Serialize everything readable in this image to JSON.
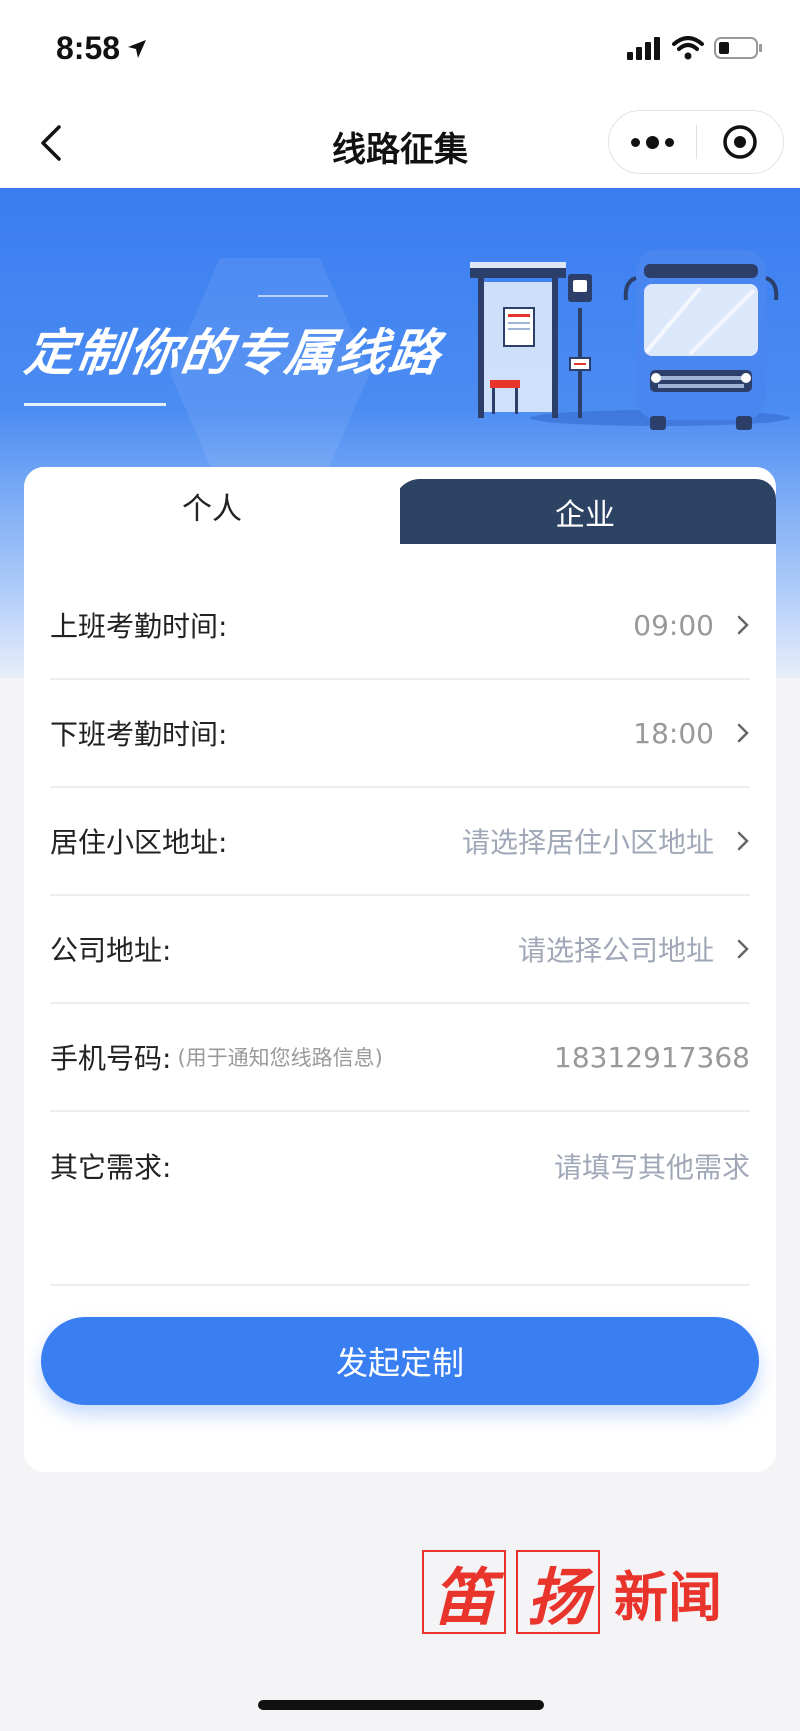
{
  "status_bar": {
    "time": "8:58",
    "icons": [
      "location-arrow-icon",
      "signal-icon",
      "wifi-icon",
      "battery-icon"
    ]
  },
  "navbar": {
    "title": "线路征集",
    "back_icon": "chevron-left-icon",
    "more_icon": "more-dots-icon",
    "close_icon": "target-circle-icon"
  },
  "banner": {
    "title": "定制你的专属线路",
    "illustration": "bus-stop-and-bus-illustration"
  },
  "tabs": [
    {
      "label": "个人",
      "active": true
    },
    {
      "label": "企业",
      "active": false
    }
  ],
  "form": {
    "work_start": {
      "label": "上班考勤时间:",
      "value": "09:00"
    },
    "work_end": {
      "label": "下班考勤时间:",
      "value": "18:00"
    },
    "home_address": {
      "label": "居住小区地址:",
      "placeholder": "请选择居住小区地址"
    },
    "company_address": {
      "label": "公司地址:",
      "placeholder": "请选择公司地址"
    },
    "phone": {
      "label": "手机号码:",
      "hint": "(用于通知您线路信息)",
      "value": "18312917368"
    },
    "other": {
      "label": "其它需求:",
      "placeholder": "请填写其他需求"
    }
  },
  "submit_label": "发起定制",
  "watermark": {
    "chars": [
      "笛",
      "扬"
    ],
    "text": "新闻"
  },
  "colors": {
    "primary": "#3a7ff1",
    "tab_dark": "#2d4364",
    "watermark_red": "#e8342b"
  }
}
